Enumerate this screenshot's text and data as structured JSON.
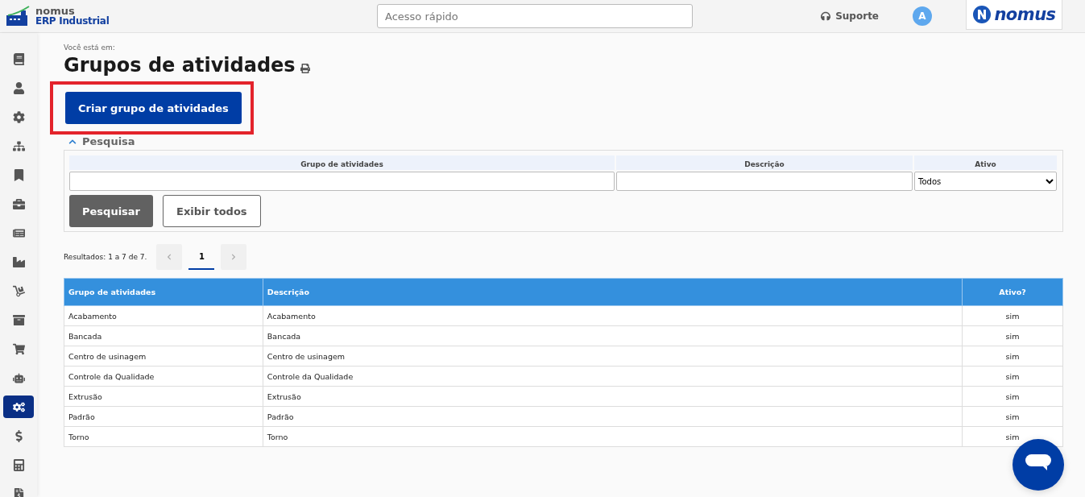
{
  "header": {
    "brand": {
      "name": "nomus",
      "product": "ERP Industrial"
    },
    "quick_access": {
      "placeholder": "Acesso rápido"
    },
    "support": "Suporte",
    "avatar": "A",
    "partner_logo": "nomus"
  },
  "sidebar": {
    "items": [
      {
        "selected": false
      },
      {
        "selected": false
      },
      {
        "selected": false
      },
      {
        "selected": false
      },
      {
        "selected": false
      },
      {
        "selected": false
      },
      {
        "selected": false
      },
      {
        "selected": false
      },
      {
        "selected": false
      },
      {
        "selected": false
      },
      {
        "selected": false
      },
      {
        "selected": false
      },
      {
        "selected": true
      },
      {
        "selected": false
      },
      {
        "selected": false
      },
      {
        "selected": false
      }
    ]
  },
  "breadcrumb_label": "Você está em:",
  "title": "Grupos de atividades",
  "create_button": {
    "label": "Criar grupo de atividades",
    "highlighted": true
  },
  "search": {
    "title": "Pesquisa",
    "expanded": true,
    "fields": [
      {
        "kind": "text",
        "label": "Grupo de atividades"
      },
      {
        "kind": "text",
        "label": "Descrição"
      },
      {
        "kind": "select",
        "label": "Ativo",
        "value": "Todos"
      }
    ],
    "buttons": [
      {
        "kind": "primary",
        "label": "Pesquisar"
      },
      {
        "kind": "outline",
        "label": "Exibir todos"
      }
    ]
  },
  "results": {
    "summary": "Resultados: 1 a 7 de 7.",
    "pages": [
      {
        "label": "1",
        "selected": true
      }
    ]
  },
  "table": {
    "columns": [
      "Grupo de atividades",
      "Descrição",
      "Ativo?"
    ],
    "rows": [
      [
        "Acabamento",
        "Acabamento",
        "sim"
      ],
      [
        "Bancada",
        "Bancada",
        "sim"
      ],
      [
        "Centro de usinagem",
        "Centro de usinagem",
        "sim"
      ],
      [
        "Controle da Qualidade",
        "Controle da Qualidade",
        "sim"
      ],
      [
        "Extrusão",
        "Extrusão",
        "sim"
      ],
      [
        "Padrão",
        "Padrão",
        "sim"
      ],
      [
        "Torno",
        "Torno",
        "sim"
      ]
    ]
  }
}
